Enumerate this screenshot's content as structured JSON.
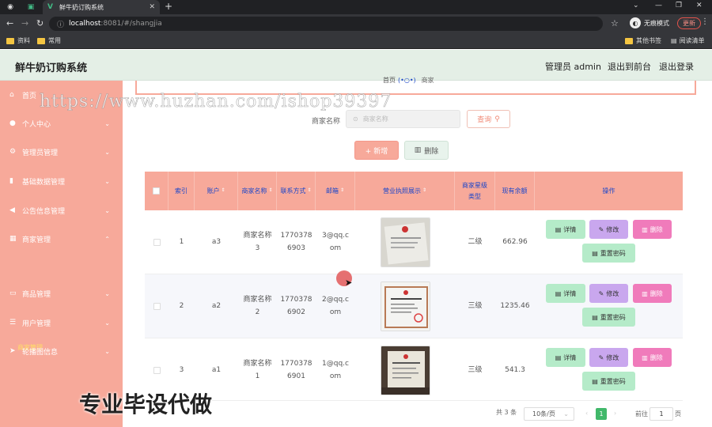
{
  "browser": {
    "tab_title": "鲜牛奶订购系统",
    "url_host": "localhost",
    "url_path": ":8081/#/shangjia",
    "profile": "无痕模式",
    "update": "更新",
    "bookmarks": [
      "资料",
      "常用",
      "其他书签",
      "阅读清单"
    ]
  },
  "header": {
    "system_name": "鲜牛奶订购系统",
    "admin": "管理员 admin",
    "back_front": "退出到前台",
    "logout": "退出登录"
  },
  "sidebar": {
    "items": [
      {
        "label": "首页",
        "icon": "home-icon"
      },
      {
        "label": "个人中心",
        "icon": "user-icon"
      },
      {
        "label": "管理员管理",
        "icon": "gear-icon"
      },
      {
        "label": "基础数据管理",
        "icon": "chart-icon"
      },
      {
        "label": "公告信息管理",
        "icon": "megaphone-icon"
      },
      {
        "label": "商家管理",
        "icon": "grid-icon"
      },
      {
        "label": "商品管理",
        "icon": "list-icon"
      },
      {
        "label": "用户管理",
        "icon": "menu-icon"
      },
      {
        "label": "轮播图信息",
        "icon": "send-icon"
      }
    ],
    "active_sub": "商家管理"
  },
  "breadcrumb": {
    "home": "首页",
    "current": "商家"
  },
  "search": {
    "label": "商家名称",
    "placeholder": "商家名称",
    "button": "查询"
  },
  "actions": {
    "add": "+ 新增",
    "delete": "删除"
  },
  "table": {
    "headers": {
      "index": "索引",
      "account": "账户",
      "name": "商家名称",
      "phone": "联系方式",
      "email": "邮箱",
      "license": "营业执照展示",
      "level": "商家星级\n类型",
      "balance": "现有余额",
      "ops": "操作"
    },
    "rows": [
      {
        "index": "1",
        "account": "a3",
        "name": "商家名称\n3",
        "phone": "1770378\n6903",
        "email": "3@qq.c\nom",
        "level": "二级",
        "balance": "662.96"
      },
      {
        "index": "2",
        "account": "a2",
        "name": "商家名称\n2",
        "phone": "1770378\n6902",
        "email": "2@qq.c\nom",
        "level": "三级",
        "balance": "1235.46"
      },
      {
        "index": "3",
        "account": "a1",
        "name": "商家名称\n1",
        "phone": "1770378\n6901",
        "email": "1@qq.c\nom",
        "level": "三级",
        "balance": "541.3"
      }
    ],
    "op_labels": {
      "detail": "详情",
      "edit": "修改",
      "delete": "删除",
      "reset": "重置密码"
    }
  },
  "pagination": {
    "total": "共 3 条",
    "size": "10条/页",
    "page": "1",
    "goto": "前往",
    "goto_value": "1",
    "unit": "页"
  },
  "overlay": {
    "watermark": "https://www.huzhan.com/ishop39397",
    "promo": "专业毕设代做"
  },
  "colors": {
    "sidebar": "#f7a99a",
    "header": "#e4efe6",
    "accent": "#41b86a"
  }
}
